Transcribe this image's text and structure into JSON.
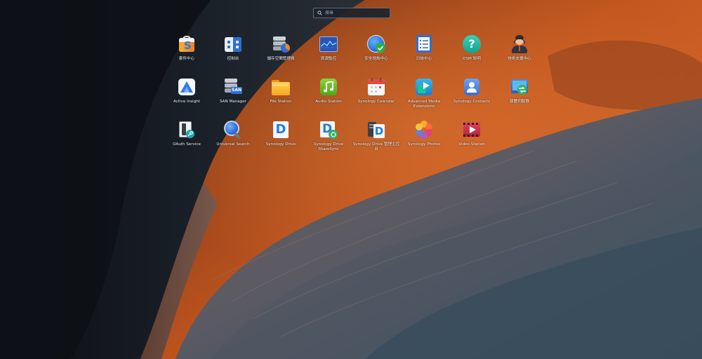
{
  "search": {
    "placeholder": "搜尋"
  },
  "apps": [
    {
      "label": "套件中心",
      "icon": "package-center-icon"
    },
    {
      "label": "控制台",
      "icon": "control-panel-icon"
    },
    {
      "label": "儲存空間管理員",
      "icon": "storage-manager-icon"
    },
    {
      "label": "資源監控",
      "icon": "resource-monitor-icon"
    },
    {
      "label": "安全諮詢中心",
      "icon": "security-advisor-icon"
    },
    {
      "label": "日誌中心",
      "icon": "log-center-icon"
    },
    {
      "label": "DSM 說明",
      "icon": "dsm-help-icon"
    },
    {
      "label": "技術支援中心",
      "icon": "support-center-icon"
    },
    {
      "label": "Active Insight",
      "icon": "active-insight-icon"
    },
    {
      "label": "SAN Manager",
      "icon": "san-manager-icon"
    },
    {
      "label": "File Station",
      "icon": "file-station-icon"
    },
    {
      "label": "Audio Station",
      "icon": "audio-station-icon"
    },
    {
      "label": "Synology Calendar",
      "icon": "synology-calendar-icon"
    },
    {
      "label": "Advanced Media\nExtensions",
      "icon": "advanced-media-extensions-icon"
    },
    {
      "label": "Synology Contacts",
      "icon": "synology-contacts-icon"
    },
    {
      "label": "媒體伺服器",
      "icon": "media-server-icon"
    },
    {
      "label": "OAuth Service",
      "icon": "oauth-service-icon"
    },
    {
      "label": "Universal Search",
      "icon": "universal-search-icon"
    },
    {
      "label": "Synology Drive",
      "icon": "synology-drive-icon"
    },
    {
      "label": "Synology Drive\nShareSync",
      "icon": "synology-drive-sharesync-icon"
    },
    {
      "label": "Synology Drive 管理主控台",
      "icon": "synology-drive-admin-console-icon"
    },
    {
      "label": "Synology Photos",
      "icon": "synology-photos-icon"
    },
    {
      "label": "Video Station",
      "icon": "video-station-icon"
    }
  ]
}
